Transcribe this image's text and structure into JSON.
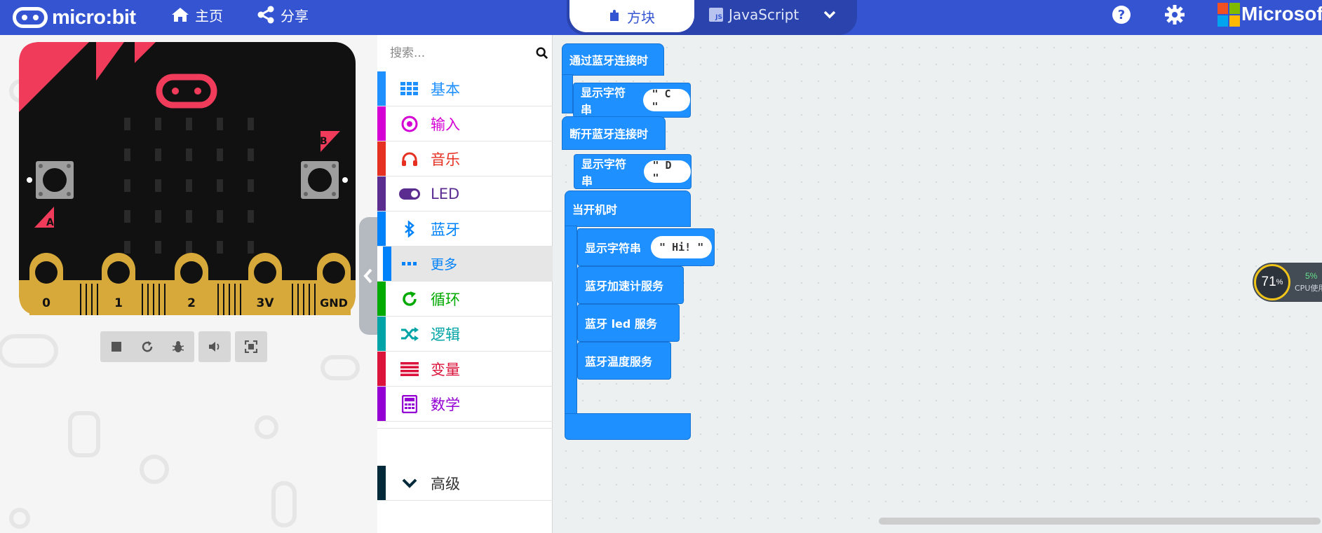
{
  "header": {
    "logo_text": "micro:bit",
    "home_label": "主页",
    "share_label": "分享",
    "tabs": {
      "blocks": "方块",
      "javascript": "JavaScript",
      "js_badge": "JS"
    },
    "brand": "Microsoft"
  },
  "simulator": {
    "led_logo": "micro:bit",
    "button_a": "A",
    "button_b": "B",
    "pins": [
      "0",
      "1",
      "2",
      "3V",
      "GND"
    ]
  },
  "toolbox": {
    "search_placeholder": "搜索...",
    "categories": [
      {
        "label": "基本",
        "color": "#1e90ff",
        "icon": "grid-icon"
      },
      {
        "label": "输入",
        "color": "#d400d4",
        "icon": "target-icon"
      },
      {
        "label": "音乐",
        "color": "#e63022",
        "icon": "headphones-icon"
      },
      {
        "label": "LED",
        "color": "#5c2d91",
        "icon": "toggle-icon"
      },
      {
        "label": "蓝牙",
        "color": "#0082fb",
        "icon": "bluetooth-icon"
      },
      {
        "label": "更多",
        "color": "#0082fb",
        "icon": "more-icon"
      },
      {
        "label": "循环",
        "color": "#00aa00",
        "icon": "loop-icon"
      },
      {
        "label": "逻辑",
        "color": "#00a4a6",
        "icon": "shuffle-icon"
      },
      {
        "label": "变量",
        "color": "#dc143c",
        "icon": "lines-icon"
      },
      {
        "label": "数学",
        "color": "#9400d3",
        "icon": "calculator-icon"
      },
      {
        "label": "高级",
        "color": "#002a3a",
        "icon": "chevron-down-icon"
      }
    ]
  },
  "workspace": {
    "blocks": {
      "on_connect": "通过蓝牙连接时",
      "show_string_1": "显示字符串",
      "value_1": "\" C \"",
      "on_disconnect": "断开蓝牙连接时",
      "show_string_2": "显示字符串",
      "value_2": "\" D \"",
      "on_start": "当开机时",
      "show_string_3": "显示字符串",
      "value_3": "\" Hi! \"",
      "accel_service": "蓝牙加速计服务",
      "led_service": "蓝牙 led 服务",
      "temp_service": "蓝牙温度服务"
    }
  },
  "cpu_widget": {
    "value": "71",
    "unit": "%",
    "small_value": "5%",
    "label": "CPU使用"
  }
}
